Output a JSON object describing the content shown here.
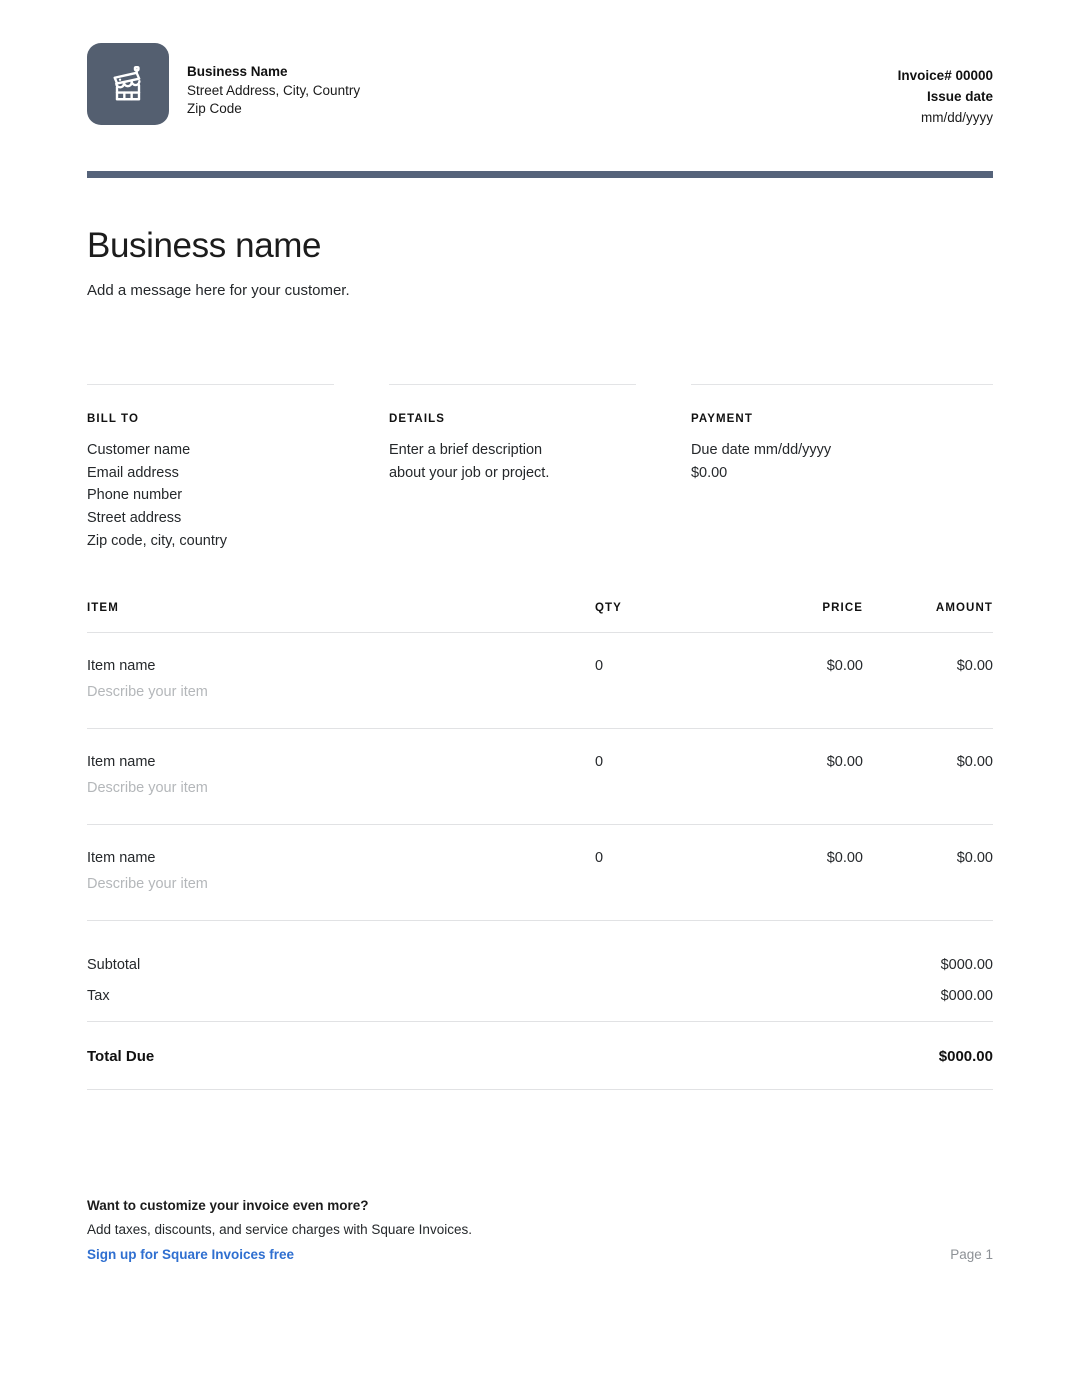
{
  "header": {
    "logo_icon": "storefront-icon",
    "logo_bg_color": "#545F70",
    "business_name": "Business Name",
    "street_address": "Street Address, City, Country",
    "zip_code": "Zip Code",
    "invoice_number": "Invoice# 00000",
    "issue_date_label": "Issue date",
    "issue_date_value": "mm/dd/yyyy"
  },
  "accent_color": "#55637A",
  "title": {
    "heading": "Business name",
    "message": "Add a message here for your customer."
  },
  "info_columns": [
    {
      "label": "BILL TO",
      "lines": [
        "Customer name",
        "Email address",
        "Phone number",
        "Street address",
        "Zip code, city, country"
      ]
    },
    {
      "label": "DETAILS",
      "lines": [
        "Enter a brief description",
        "about your job or project."
      ]
    },
    {
      "label": "PAYMENT",
      "lines": [
        "Due date mm/dd/yyyy",
        "$0.00"
      ]
    }
  ],
  "items_table": {
    "headers": {
      "item": "ITEM",
      "qty": "QTY",
      "price": "PRICE",
      "amount": "AMOUNT"
    },
    "rows": [
      {
        "name": "Item name",
        "description": "Describe your item",
        "qty": "0",
        "price": "$0.00",
        "amount": "$0.00"
      },
      {
        "name": "Item name",
        "description": "Describe your item",
        "qty": "0",
        "price": "$0.00",
        "amount": "$0.00"
      },
      {
        "name": "Item name",
        "description": "Describe your item",
        "qty": "0",
        "price": "$0.00",
        "amount": "$0.00"
      }
    ]
  },
  "totals": {
    "subtotal_label": "Subtotal",
    "subtotal_value": "$000.00",
    "tax_label": "Tax",
    "tax_value": "$000.00",
    "total_due_label": "Total Due",
    "total_due_value": "$000.00"
  },
  "footer": {
    "title": "Want to customize your invoice even more?",
    "subtitle": "Add taxes, discounts, and service charges with Square Invoices.",
    "link_text": "Sign up for Square Invoices free",
    "link_color": "#2f6fd0",
    "page_label": "Page 1"
  }
}
